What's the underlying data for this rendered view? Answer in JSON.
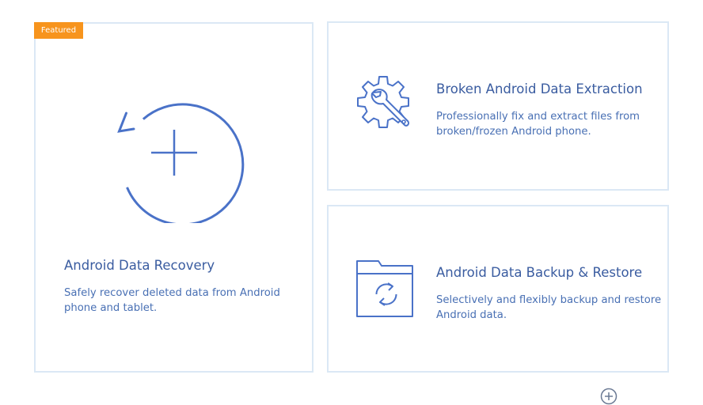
{
  "cards": {
    "recovery": {
      "badge": "Featured",
      "title": "Android Data Recovery",
      "description": "Safely recover deleted data from Android phone and tablet.",
      "icon": "recover-arrow-plus-icon"
    },
    "broken": {
      "title": "Broken Android Data Extraction",
      "description": "Professionally fix and extract files from broken/frozen Android phone.",
      "icon": "gear-wrench-icon"
    },
    "backup": {
      "title": "Android Data Backup & Restore",
      "description": "Selectively and flexibly backup and restore Android data.",
      "icon": "folder-sync-icon"
    }
  },
  "footer": {
    "more_icon": "more-circle-icon"
  },
  "colors": {
    "accent_blue": "#4a72c8",
    "title_blue": "#3a5ca0",
    "card_border": "#dbe8f5",
    "badge_orange": "#f7941d"
  }
}
